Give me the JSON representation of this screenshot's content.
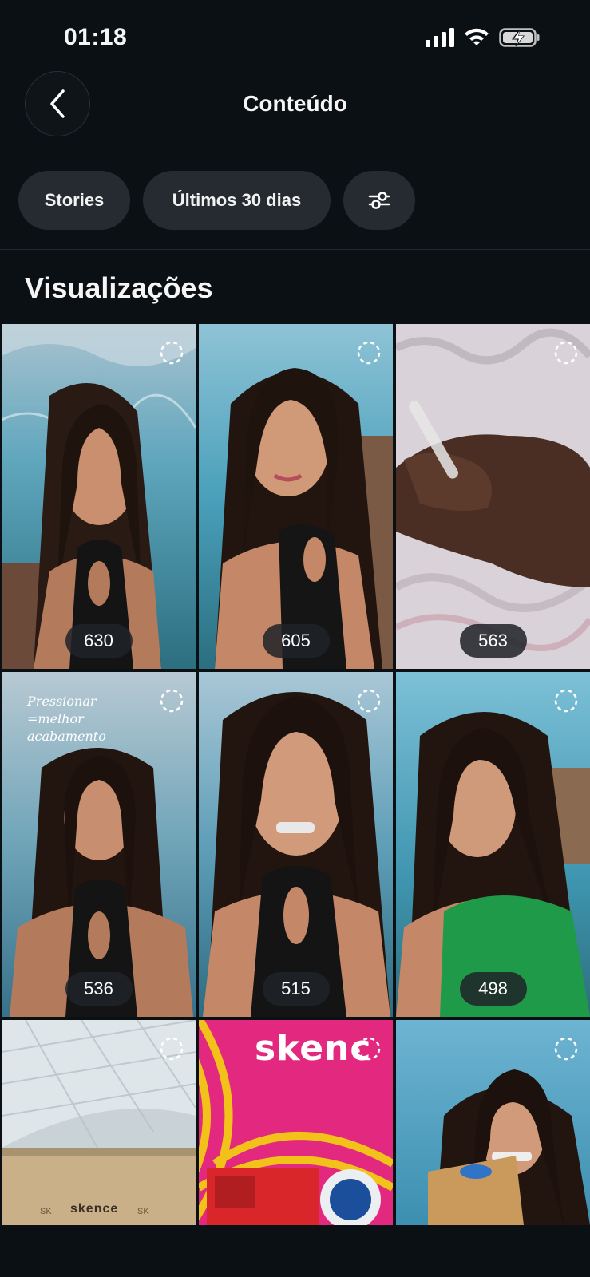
{
  "status": {
    "time": "01:18"
  },
  "header": {
    "title": "Conteúdo"
  },
  "filters": {
    "type": "Stories",
    "period": "Últimos 30 dias"
  },
  "section": {
    "title": "Visualizações"
  },
  "tiles": [
    {
      "views": "630",
      "scene": "person-black-top"
    },
    {
      "views": "605",
      "scene": "person-black-top"
    },
    {
      "views": "563",
      "scene": "hand-with-tube"
    },
    {
      "views": "536",
      "scene": "person-black-top",
      "caption": "Pressionar =melhor acabamento"
    },
    {
      "views": "515",
      "scene": "person-black-top"
    },
    {
      "views": "498",
      "scene": "person-green-top"
    },
    {
      "scene": "skence-box",
      "brand": "skence"
    },
    {
      "scene": "skence-package",
      "brand": "skenc"
    },
    {
      "scene": "person-with-box"
    }
  ],
  "colors": {
    "background": "#0b1014",
    "chip": "#262b31",
    "badge": "#1e2228"
  }
}
